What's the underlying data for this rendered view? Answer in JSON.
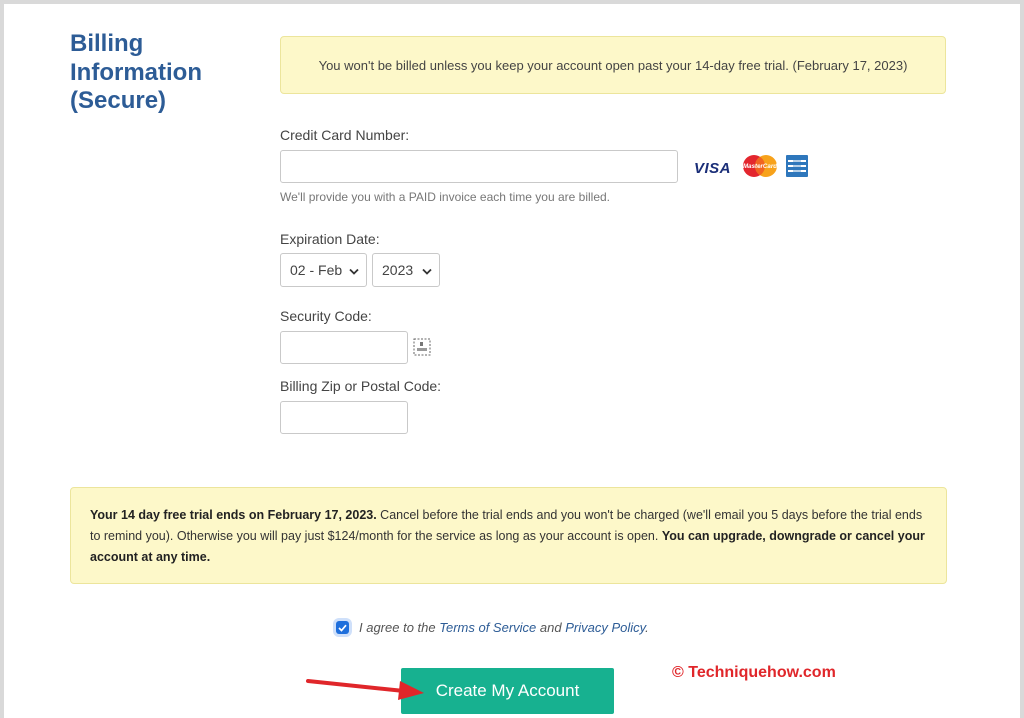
{
  "section": {
    "title": "Billing Information (Secure)"
  },
  "notice_top": {
    "text": "You won't be billed unless you keep your account open past your 14-day free trial. (February 17, 2023)"
  },
  "credit_card": {
    "label": "Credit Card Number:",
    "value": "",
    "hint": "We'll provide you with a PAID invoice each time you are billed.",
    "cards": [
      "visa-icon",
      "mastercard-icon",
      "amex-icon"
    ],
    "visa_text": "VISA",
    "mastercard_text": "MasterCard"
  },
  "expiration": {
    "label": "Expiration Date:",
    "month": "02 - Feb",
    "year": "2023"
  },
  "security_code": {
    "label": "Security Code:",
    "value": ""
  },
  "zip": {
    "label": "Billing Zip or Postal Code:",
    "value": ""
  },
  "notice_bottom": {
    "bold1": "Your 14 day free trial ends on February 17, 2023.",
    "text1": " Cancel before the trial ends and you won't be charged (we'll email you 5 days before the trial ends to remind you). Otherwise you will pay just $124/month for the service as long as your account is open. ",
    "bold2": "You can upgrade, downgrade or cancel your account at any time."
  },
  "agreement": {
    "checked": true,
    "prefix": "I agree to the ",
    "terms_link": "Terms of Service",
    "and": " and ",
    "privacy_link": "Privacy Policy",
    "suffix": "."
  },
  "cta": {
    "label": "Create My Account"
  },
  "watermark": {
    "text": "© Techniquehow.com"
  },
  "colors": {
    "accent": "#17b190",
    "heading": "#2d5c96",
    "notice_bg": "#fdf8c9",
    "arrow": "#e0262a"
  }
}
